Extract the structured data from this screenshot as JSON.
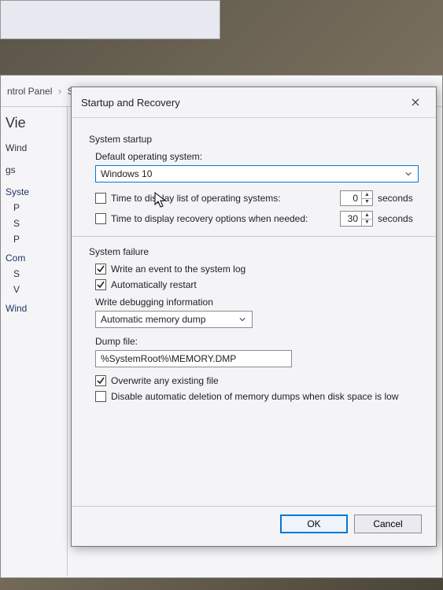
{
  "desktop": {
    "breadcrumb_parent": "ntrol Panel",
    "breadcrumb_current": "S"
  },
  "parentWindow": {
    "heading": "Vie",
    "sidebar_items": [
      "Wind",
      "gs"
    ],
    "section_labels": [
      "Syste",
      "Com",
      "Wind"
    ],
    "sub_items": [
      "P",
      "S",
      "P",
      "S",
      "V"
    ]
  },
  "dialog": {
    "title": "Startup and Recovery",
    "startup": {
      "header": "System startup",
      "default_os_label": "Default operating system:",
      "default_os_value": "Windows 10",
      "display_list": {
        "checked": false,
        "label": "Time to display list of operating systems:",
        "value": "0",
        "unit": "seconds"
      },
      "display_recovery": {
        "checked": false,
        "label": "Time to display recovery options when needed:",
        "value": "30",
        "unit": "seconds"
      }
    },
    "failure": {
      "header": "System failure",
      "write_event": {
        "checked": true,
        "label": "Write an event to the system log"
      },
      "auto_restart": {
        "checked": true,
        "label": "Automatically restart"
      },
      "debug_label": "Write debugging information",
      "debug_value": "Automatic memory dump",
      "dump_label": "Dump file:",
      "dump_value": "%SystemRoot%\\MEMORY.DMP",
      "overwrite": {
        "checked": true,
        "label": "Overwrite any existing file"
      },
      "disable_delete": {
        "checked": false,
        "label": "Disable automatic deletion of memory dumps when disk space is low"
      }
    },
    "buttons": {
      "ok": "OK",
      "cancel": "Cancel"
    }
  }
}
